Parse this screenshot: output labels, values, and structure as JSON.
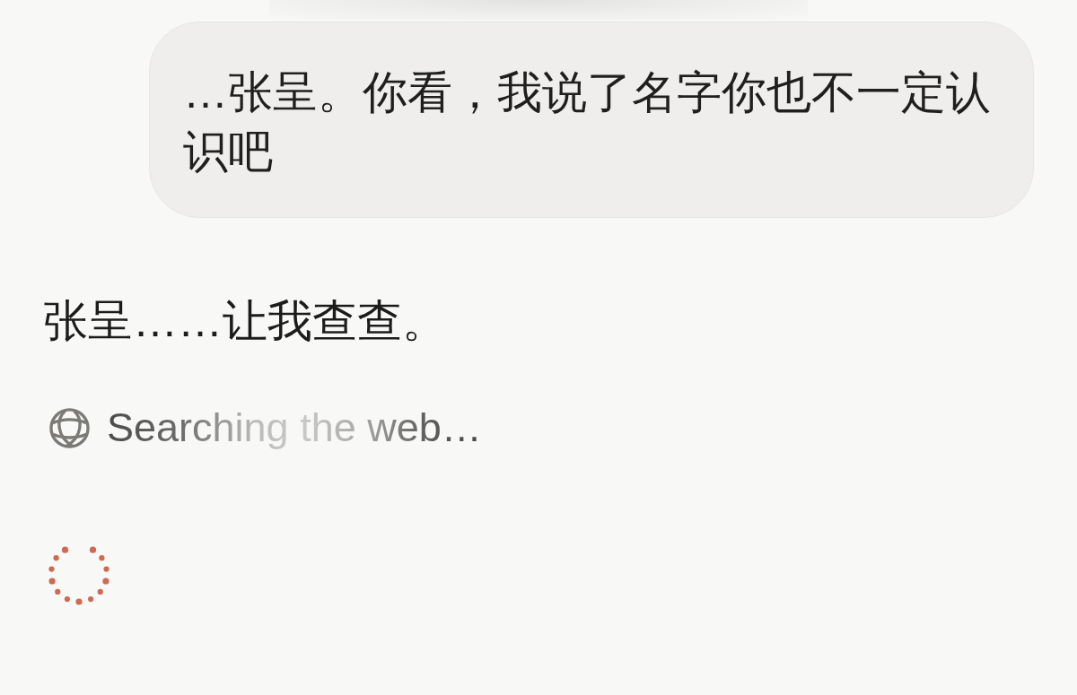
{
  "messages": [
    {
      "kind": "user",
      "text": "…张呈。你看，我说了名字你也不一定认识吧"
    },
    {
      "kind": "assistant",
      "text": "张呈……让我查查。"
    }
  ],
  "status": {
    "kind": "web_search",
    "label": "Searching the web…"
  },
  "loading": true
}
